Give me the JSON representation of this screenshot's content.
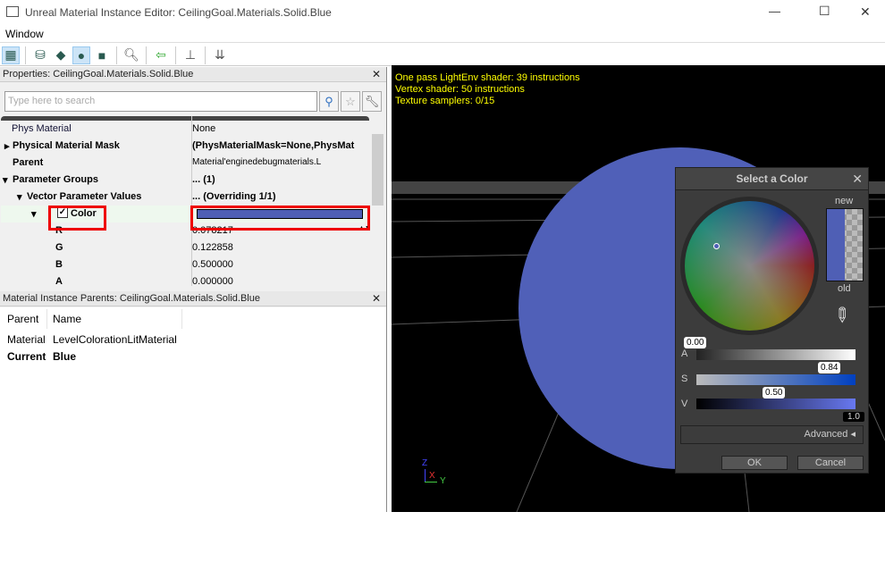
{
  "window": {
    "title": "Unreal Material Instance Editor: CeilingGoal.Materials.Solid.Blue",
    "minimize": "—",
    "maximize": "☐",
    "close": "✕"
  },
  "menu": {
    "window": "Window"
  },
  "toolbar": [
    "grid-icon",
    "cylinder-icon",
    "cube-icon",
    "sphere-icon",
    "plane-icon",
    "find-icon",
    "back-arrow-icon",
    "pivot-icon",
    "realtime-icon"
  ],
  "properties": {
    "title": "Properties: CeilingGoal.Materials.Solid.Blue",
    "search_placeholder": "Type here to search",
    "rows": [
      {
        "name": "Phys Material",
        "value": "None",
        "bold": false
      },
      {
        "name": "Physical Material Mask",
        "value": "(PhysMaterialMask=None,PhysMat",
        "bold": true
      },
      {
        "name": "Parent",
        "value": "Material'enginedebugmaterials.L",
        "bold": false
      },
      {
        "name": "Parameter Groups",
        "value": "... (1)",
        "bold": true
      },
      {
        "name": "Vector Parameter Values",
        "value": "... (Overriding 1/1)",
        "bold": true
      },
      {
        "name": "Color",
        "value": "",
        "bold": true
      },
      {
        "name": "R",
        "value": "0.078217",
        "bold": true
      },
      {
        "name": "G",
        "value": "0.122858",
        "bold": true
      },
      {
        "name": "B",
        "value": "0.500000",
        "bold": true
      },
      {
        "name": "A",
        "value": "0.000000",
        "bold": true
      }
    ],
    "color_swatch": "#4f5fb5"
  },
  "parents": {
    "title": "Material Instance Parents: CeilingGoal.Materials.Solid.Blue",
    "headers": [
      "Parent",
      "Name"
    ],
    "rows": [
      [
        "Material",
        "LevelColorationLitMaterial"
      ],
      [
        "Current",
        "Blue"
      ]
    ]
  },
  "viewport": {
    "stats": [
      "One pass LightEnv shader: 39 instructions",
      "Vertex shader: 50 instructions",
      "Texture samplers: 0/15"
    ],
    "axes": {
      "z": "Z",
      "y": "Y",
      "x": "X"
    }
  },
  "color_picker": {
    "title": "Select a Color",
    "new_label": "new",
    "old_label": "old",
    "a_label": "A",
    "s_label": "S",
    "v_label": "V",
    "a_value": "0.00",
    "s_value": "0.84",
    "v_value": "0.50",
    "max_value": "1.0",
    "advanced": "Advanced ◂",
    "ok": "OK",
    "cancel": "Cancel",
    "color": "#4f5fb5"
  }
}
